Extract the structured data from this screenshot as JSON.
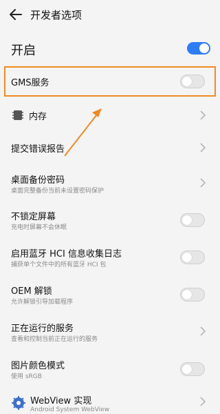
{
  "header": {
    "title": "开发者选项"
  },
  "master": {
    "label": "开启",
    "enabled": true
  },
  "rows": {
    "gms": {
      "label": "GMS服务",
      "toggle": false
    },
    "memory": {
      "label": "内存"
    },
    "bugreport": {
      "label": "提交错误报告"
    },
    "backup": {
      "label": "桌面备份密码",
      "sub": "桌面完整备份当前未设置密码保护"
    },
    "stayawake": {
      "label": "不锁定屏幕",
      "sub": "充电时屏幕不会休眠",
      "toggle": false
    },
    "hcilog": {
      "label": "启用蓝牙 HCI 信息收集日志",
      "sub": "捕获单个文件中的所有蓝牙 HCI 包",
      "toggle": false
    },
    "oem": {
      "label": "OEM 解锁",
      "sub": "允许解锁引导加载程序",
      "toggle": false
    },
    "running": {
      "label": "正在运行的服务",
      "sub": "查看和控制当前正在运行的服务"
    },
    "colormode": {
      "label": "图片颜色模式",
      "sub": "使用 sRGB",
      "toggle": false
    },
    "webview": {
      "label": "WebView 实现",
      "sub": "Android System WebView"
    }
  },
  "colors": {
    "accent": "#2e7cf6",
    "highlight": "#f08a24",
    "background": "#f4f4f4"
  },
  "icons": {
    "back": "arrow-left-icon",
    "memory": "chip-icon",
    "webview": "webview-gear-icon",
    "chevron": "chevron-right-icon"
  }
}
